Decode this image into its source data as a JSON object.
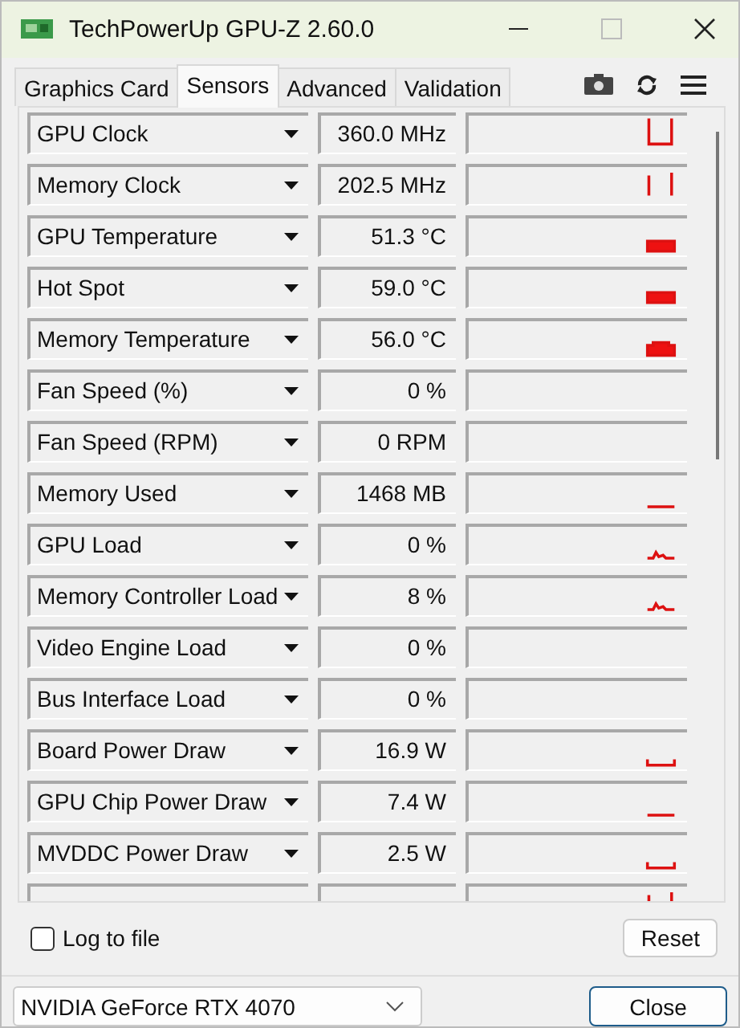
{
  "window": {
    "title": "TechPowerUp GPU-Z 2.60.0"
  },
  "tabs": [
    {
      "label": "Graphics Card",
      "selected": false
    },
    {
      "label": "Sensors",
      "selected": true
    },
    {
      "label": "Advanced",
      "selected": false
    },
    {
      "label": "Validation",
      "selected": false
    }
  ],
  "sensors": [
    {
      "name": "GPU Clock",
      "value": "360.0 MHz",
      "kind": "step"
    },
    {
      "name": "Memory Clock",
      "value": "202.5 MHz",
      "kind": "bars"
    },
    {
      "name": "GPU Temperature",
      "value": "51.3 °C",
      "kind": "block"
    },
    {
      "name": "Hot Spot",
      "value": "59.0 °C",
      "kind": "block"
    },
    {
      "name": "Memory Temperature",
      "value": "56.0 °C",
      "kind": "notch"
    },
    {
      "name": "Fan Speed (%)",
      "value": "0 %",
      "kind": "flat"
    },
    {
      "name": "Fan Speed (RPM)",
      "value": "0 RPM",
      "kind": "flat"
    },
    {
      "name": "Memory Used",
      "value": "1468 MB",
      "kind": "line"
    },
    {
      "name": "GPU Load",
      "value": "0 %",
      "kind": "bump"
    },
    {
      "name": "Memory Controller Load",
      "value": "8 %",
      "kind": "bump"
    },
    {
      "name": "Video Engine Load",
      "value": "0 %",
      "kind": "flat"
    },
    {
      "name": "Bus Interface Load",
      "value": "0 %",
      "kind": "flat"
    },
    {
      "name": "Board Power Draw",
      "value": "16.9 W",
      "kind": "dip"
    },
    {
      "name": "GPU Chip Power Draw",
      "value": "7.4 W",
      "kind": "low"
    },
    {
      "name": "MVDDC Power Draw",
      "value": "2.5 W",
      "kind": "dip"
    },
    {
      "kind": "bars"
    }
  ],
  "log_to_file": {
    "label": "Log to file",
    "checked": false
  },
  "reset_button": "Reset",
  "gpu_select": {
    "value": "NVIDIA GeForce RTX 4070"
  },
  "close_button": "Close"
}
